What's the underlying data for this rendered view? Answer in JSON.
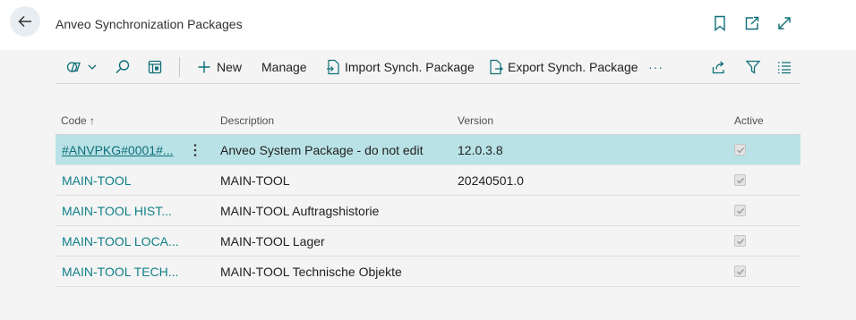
{
  "header": {
    "title": "Anveo Synchronization Packages"
  },
  "toolbar": {
    "new_label": "New",
    "manage_label": "Manage",
    "import_label": "Import Synch. Package",
    "export_label": "Export Synch. Package",
    "more_label": "···"
  },
  "grid": {
    "columns": {
      "code": "Code",
      "sort_indicator": "↑",
      "description": "Description",
      "version": "Version",
      "active": "Active"
    },
    "rows": [
      {
        "code": "#ANVPKG#0001#...",
        "description": "Anveo System Package - do not edit",
        "version": "12.0.3.8",
        "active": true
      },
      {
        "code": "MAIN-TOOL",
        "description": "MAIN-TOOL",
        "version": "20240501.0",
        "active": true
      },
      {
        "code": "MAIN-TOOL HIST...",
        "description": "MAIN-TOOL Auftragshistorie",
        "version": "",
        "active": true
      },
      {
        "code": "MAIN-TOOL LOCA...",
        "description": "MAIN-TOOL Lager",
        "version": "",
        "active": true
      },
      {
        "code": "MAIN-TOOL TECH...",
        "description": "MAIN-TOOL Technische Objekte",
        "version": "",
        "active": true
      }
    ]
  },
  "colors": {
    "accent": "#0f7f87",
    "selected_row": "#b9e2e6",
    "icon": "#0e6f77"
  }
}
